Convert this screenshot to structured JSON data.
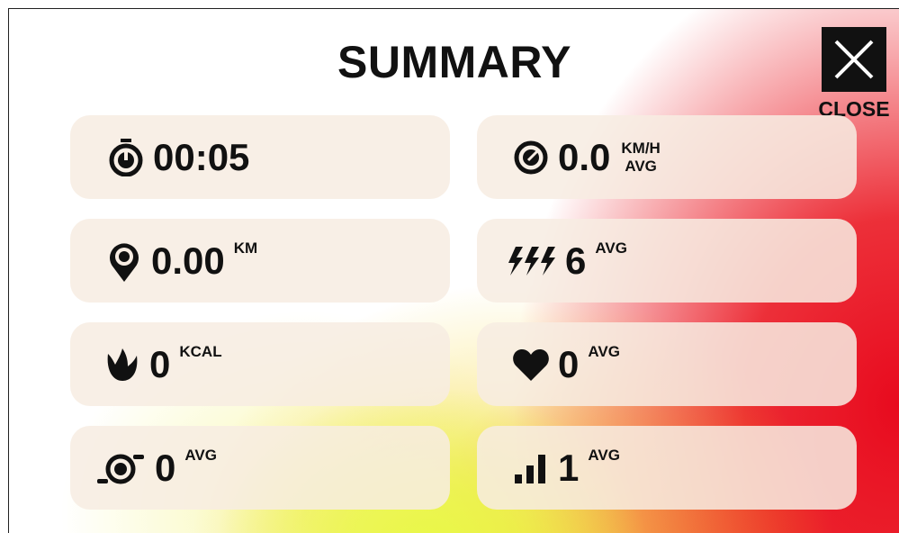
{
  "title": "SUMMARY",
  "close": {
    "label": "CLOSE"
  },
  "metrics": {
    "time": {
      "value": "00:05",
      "icon": "stopwatch-icon"
    },
    "speed": {
      "value": "0.0",
      "unit_top": "KM/H",
      "unit_bottom": "AVG",
      "icon": "speedometer-icon"
    },
    "distance": {
      "value": "0.00",
      "unit": "KM",
      "icon": "location-pin-icon"
    },
    "power": {
      "value": "6",
      "unit": "AVG",
      "icon": "lightning-bolts-icon"
    },
    "calories": {
      "value": "0",
      "unit": "KCAL",
      "icon": "flame-icon"
    },
    "heart_rate": {
      "value": "0",
      "unit": "AVG",
      "icon": "heart-icon"
    },
    "cadence": {
      "value": "0",
      "unit": "AVG",
      "icon": "cadence-icon"
    },
    "level": {
      "value": "1",
      "unit": "AVG",
      "icon": "signal-bars-icon"
    }
  },
  "colors": {
    "text": "#111111",
    "card": "#f7ece2",
    "accent_red": "#e80a1e",
    "accent_yellow": "#e8fa46"
  }
}
